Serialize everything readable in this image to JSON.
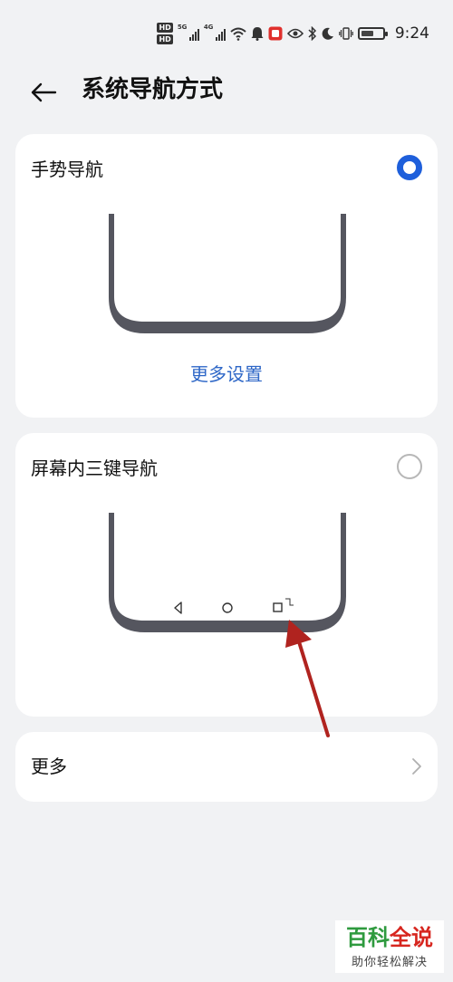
{
  "status_bar": {
    "time": "9:24",
    "sim1_badge": "HD",
    "sim2_badge": "HD",
    "sim1_tech": "5G",
    "sim2_tech": "4G",
    "icons": [
      "signal-icon",
      "wifi-icon",
      "notification-icon",
      "app-icon",
      "eye-icon",
      "bluetooth-icon",
      "moon-icon",
      "vibrate-icon",
      "battery-icon"
    ],
    "battery_level": 0.6
  },
  "header": {
    "title": "系统导航方式"
  },
  "options": [
    {
      "label": "手势导航",
      "selected": true,
      "link": "更多设置"
    },
    {
      "label": "屏幕内三键导航",
      "selected": false
    }
  ],
  "more_row": {
    "label": "更多"
  },
  "colors": {
    "accent": "#1e5fdb",
    "link": "#2e67c7",
    "phone_frame": "#55565f",
    "annotation_arrow": "#b0231f",
    "watermark_green": "#2e9a3e",
    "watermark_red": "#d7261f"
  },
  "watermark": {
    "part1": "百科",
    "part2": "全说",
    "tagline": "助你轻松解决"
  }
}
